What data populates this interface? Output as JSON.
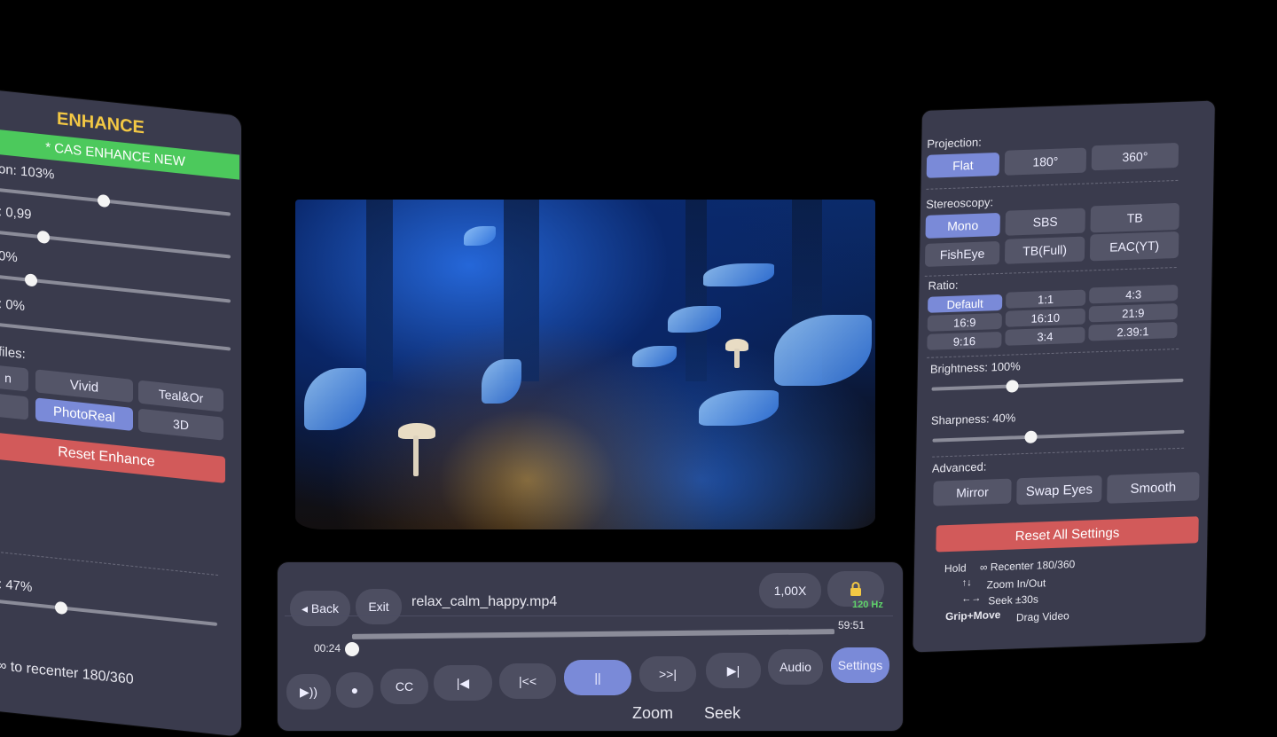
{
  "enhance_panel": {
    "title": "ENHANCE",
    "mode_banner": "* CAS ENHANCE NEW",
    "sliders": [
      {
        "label": "on: 103%",
        "value": 0.45
      },
      {
        "label": ": 0,99",
        "value": 0.18
      },
      {
        "label": "0%",
        "value": 0.12
      },
      {
        "label": ": 0%",
        "value": 0.0
      }
    ],
    "profiles_label": "files:",
    "profiles_row1": [
      "n",
      "Vivid",
      "Teal&Or"
    ],
    "profiles_row2": [
      "",
      "PhotoReal",
      "3D"
    ],
    "selected_profile": "PhotoReal",
    "reset_label": "Reset Enhance",
    "bottom_slider": {
      "label": ": 47%",
      "value": 0.47
    },
    "recenter_hint": "∞ to recenter 180/360"
  },
  "settings_panel": {
    "projection_label": "Projection:",
    "projection": [
      "Flat",
      "180°",
      "360°"
    ],
    "projection_selected": "Flat",
    "stereoscopy_label": "Stereoscopy:",
    "stereoscopy_row1": [
      "Mono",
      "SBS",
      "TB"
    ],
    "stereoscopy_row2": [
      "FishEye",
      "TB(Full)",
      "EAC(YT)"
    ],
    "stereoscopy_selected": "Mono",
    "ratio_label": "Ratio:",
    "ratio_rows": [
      [
        "Default",
        "1:1",
        "4:3"
      ],
      [
        "16:9",
        "16:10",
        "21:9"
      ],
      [
        "9:16",
        "3:4",
        "2.39:1"
      ]
    ],
    "ratio_selected": "Default",
    "brightness_label": "Brightness: 100%",
    "brightness_value": 0.3,
    "sharpness_label": "Sharpness: 40%",
    "sharpness_value": 0.37,
    "advanced_label": "Advanced:",
    "advanced": [
      "Mirror",
      "Swap Eyes",
      "Smooth"
    ],
    "reset_all_label": "Reset All Settings",
    "hints": [
      {
        "key": "Hold",
        "action": "∞ Recenter 180/360"
      },
      {
        "key": "↑↓",
        "action": "Zoom In/Out"
      },
      {
        "key": "←→",
        "action": "Seek ±30s"
      },
      {
        "key": "Grip+Move",
        "action": "Drag Video"
      }
    ]
  },
  "controls": {
    "back_label": "◂ Back",
    "exit_label": "Exit",
    "filename": "relax_calm_happy.mp4",
    "speed_label": "1,00X",
    "lock_icon": "lock-icon",
    "refresh_rate": "120 Hz",
    "elapsed": "00:24",
    "duration": "59:51",
    "progress": 0.007,
    "buttons": [
      "▶))",
      "●",
      "CC",
      "|◀",
      "|<<",
      "||",
      ">>|",
      "▶|",
      "Audio",
      "Settings"
    ],
    "footer_hint": "Zoom  Seek"
  },
  "colors": {
    "panel": "#3a3b4d",
    "button": "#545568",
    "selected": "#7a8ad8",
    "banner_green": "#4cc95c",
    "reset_red": "#d25a5a",
    "title_yellow": "#f3c844",
    "hz_green": "#5fd36a"
  }
}
